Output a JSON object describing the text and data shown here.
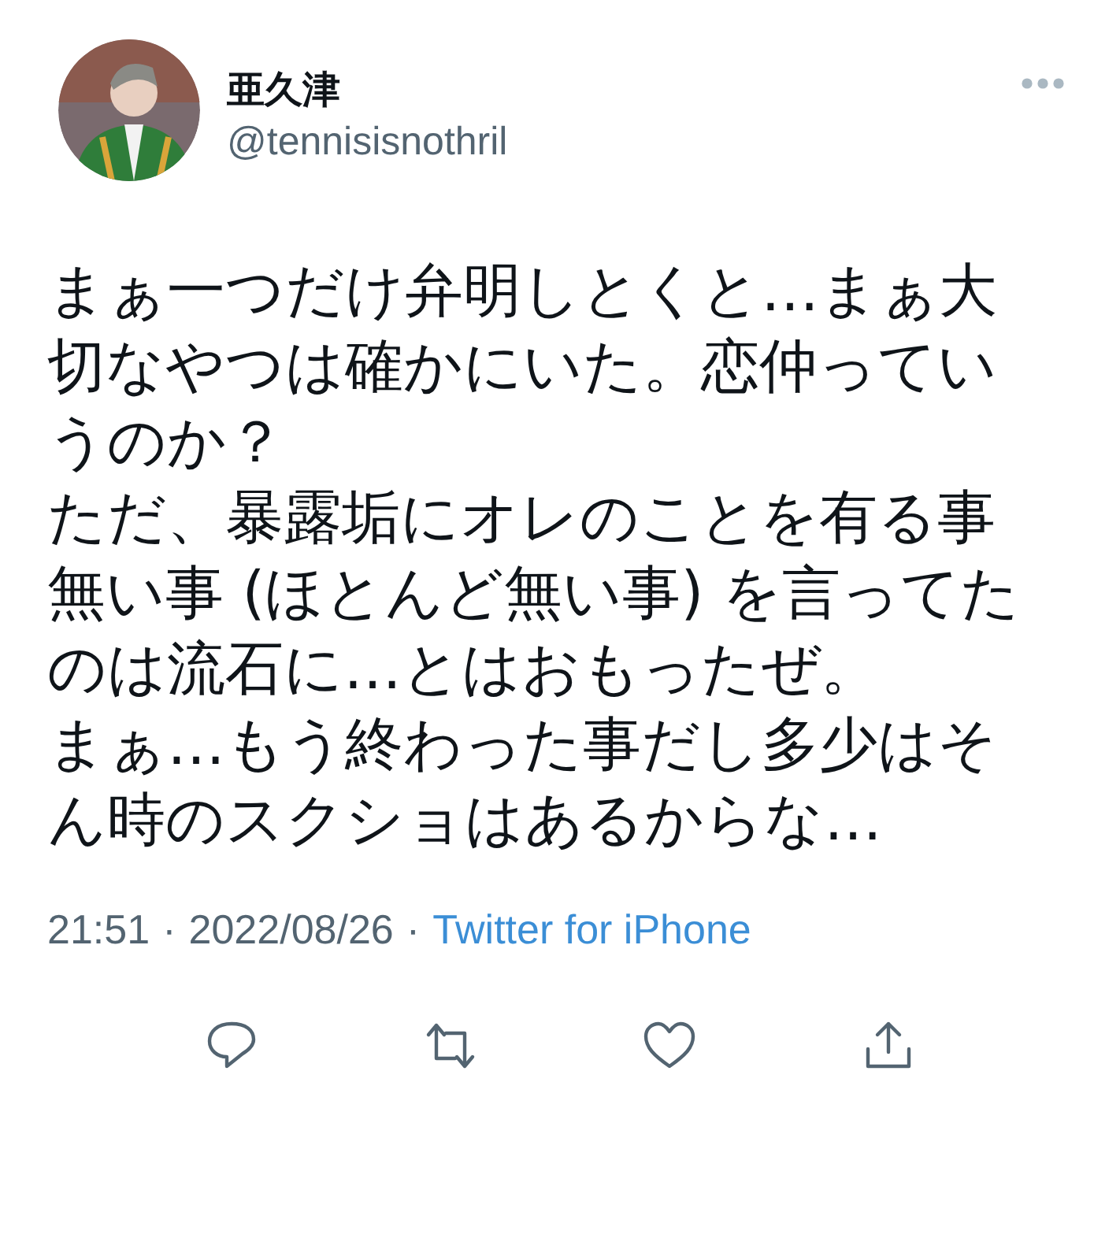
{
  "author": {
    "name": "亜久津",
    "handle": "@tennisisnothril"
  },
  "paragraphs": [
    "まぁ一つだけ弁明しとくと…まぁ大切なやつは確かにいた。恋仲っていうのか？",
    "ただ、暴露垢にオレのことを有る事無い事 (ほとんど無い事) を言ってたのは流石に…とはおもったぜ。",
    "まぁ…もう終わった事だし多少はそん時のスクショはあるからな…"
  ],
  "meta": {
    "time": "21:51",
    "separator_1": "·",
    "date": "2022/08/26",
    "separator_2": "·",
    "source": "Twitter for iPhone"
  }
}
